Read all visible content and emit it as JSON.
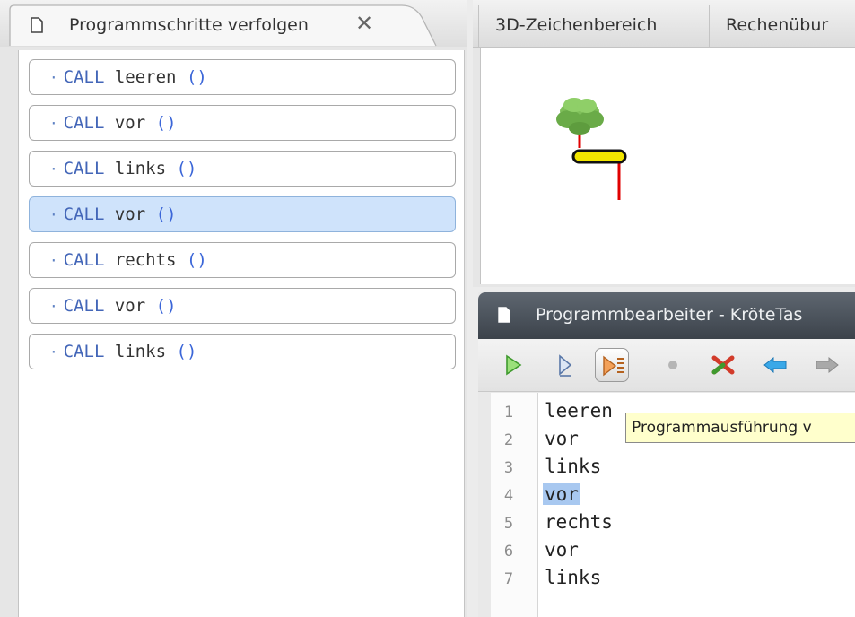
{
  "left_panel": {
    "tab_title": "Programmschritte verfolgen",
    "tab_close": "✕",
    "steps": [
      {
        "keyword": "CALL",
        "name": "leeren",
        "parens": "()",
        "selected": false
      },
      {
        "keyword": "CALL",
        "name": "vor",
        "parens": "()",
        "selected": false
      },
      {
        "keyword": "CALL",
        "name": "links",
        "parens": "()",
        "selected": false
      },
      {
        "keyword": "CALL",
        "name": "vor",
        "parens": "()",
        "selected": true
      },
      {
        "keyword": "CALL",
        "name": "rechts",
        "parens": "()",
        "selected": false
      },
      {
        "keyword": "CALL",
        "name": "vor",
        "parens": "()",
        "selected": false
      },
      {
        "keyword": "CALL",
        "name": "links",
        "parens": "()",
        "selected": false
      }
    ]
  },
  "right_top": {
    "tabs": [
      "3D-Zeichenbereich",
      "Rechenübur"
    ]
  },
  "editor": {
    "title": "Programmbearbeiter - KröteTas",
    "toolbar": [
      "run-icon",
      "step-icon",
      "step-over-icon",
      "stop-icon",
      "cancel-icon",
      "back-arrow-icon",
      "forward-arrow-icon"
    ],
    "lines": [
      {
        "no": "1",
        "text": "leeren",
        "highlight": false
      },
      {
        "no": "2",
        "text": "vor",
        "highlight": false
      },
      {
        "no": "3",
        "text": "links",
        "highlight": false
      },
      {
        "no": "4",
        "text": "vor",
        "highlight": true
      },
      {
        "no": "5",
        "text": "rechts",
        "highlight": false
      },
      {
        "no": "6",
        "text": "vor",
        "highlight": false
      },
      {
        "no": "7",
        "text": "links",
        "highlight": false
      }
    ],
    "tooltip": "Programmausführung v"
  },
  "colors": {
    "selection": "#cfe3fb",
    "code_highlight": "#a8c8f0",
    "keyword": "#4366b8",
    "tooltip_bg": "#ffffcc",
    "turtle_body": "#f2e600",
    "turtle_path": "#e00000"
  }
}
